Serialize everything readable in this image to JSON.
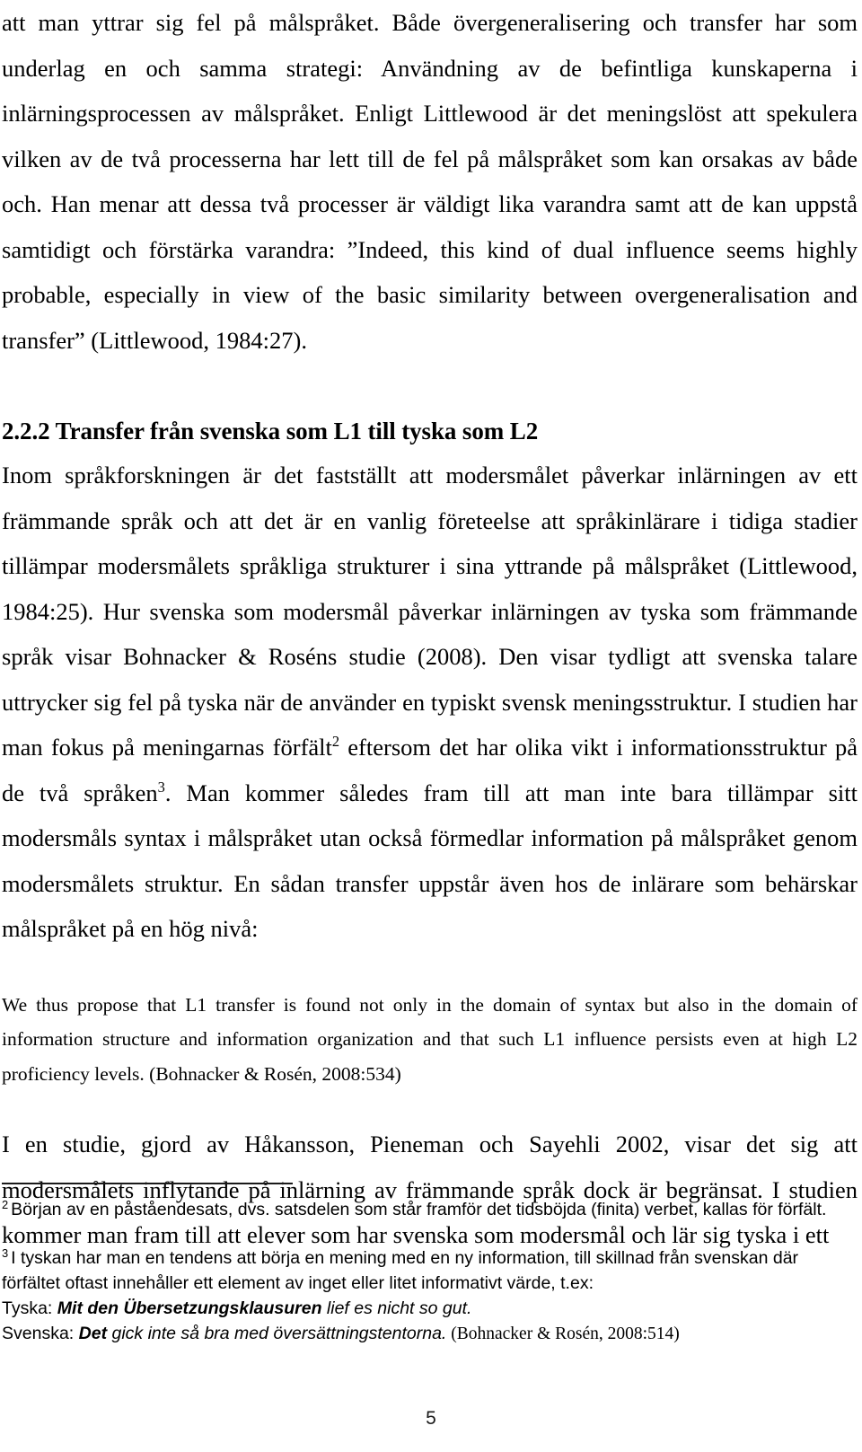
{
  "document": {
    "page_number": "5",
    "language": "sv"
  },
  "body": {
    "paragraph_1": "att man yttrar sig fel på målspråket. Både övergeneralisering och transfer har som underlag en och samma strategi: Användning av de befintliga kunskaperna i inlärningsprocessen av målspråket. Enligt Littlewood är det meningslöst att spekulera vilken av de två processerna har lett till de fel på målspråket som kan orsakas av både och. Han menar att dessa två processer är väldigt lika varandra samt att de kan uppstå samtidigt och förstärka varandra: ”Indeed, this kind of dual influence seems highly probable, especially in view of the basic similarity between overgeneralisation and transfer” (Littlewood, 1984:27).",
    "heading_2_2_2": "2.2.2 Transfer från svenska som L1 till tyska som L2",
    "paragraph_2_part_a": "Inom språkforskningen är det fastställt att modersmålet påverkar inlärningen av ett främmande språk och att det är en vanlig företeelse att språkinlärare i tidiga stadier tillämpar modersmålets språkliga strukturer i sina yttrande på målspråket (Littlewood, 1984:25). Hur svenska som modersmål påverkar inlärningen av tyska som främmande språk visar Bohnacker & Roséns studie (2008). Den visar tydligt att svenska talare uttrycker sig fel på tyska när de använder en typiskt svensk meningsstruktur. I studien har man fokus på meningarnas förfält",
    "footnote_ref_2": "2",
    "paragraph_2_part_b": " eftersom det har olika vikt i informationsstruktur på de två språken",
    "footnote_ref_3": "3",
    "paragraph_2_part_c": ". Man kommer således fram till att man inte bara tillämpar sitt modersmåls syntax i målspråket utan också förmedlar information på målspråket genom modersmålets struktur. En sådan transfer uppstår även hos de inlärare som behärskar målspråket på en hög nivå:",
    "blockquote": "We thus propose that L1 transfer is found not only in the domain of syntax but also in the domain of information structure and information organization and that such L1 influence persists even at high L2 proficiency levels. (Bohnacker & Rosén, 2008:534)",
    "paragraph_3": "I en studie, gjord av Håkansson, Pieneman och Sayehli 2002, visar det sig att modersmålets inflytande på inlärning av främmande språk dock är begränsat. I studien kommer man fram till att elever som har svenska som modersmål och lär sig tyska i ett"
  },
  "footnotes": {
    "note_2": {
      "number": "2",
      "text": "Början av en påståendesats, dvs. satsdelen som står framför det tidsböjda (finita) verbet, kallas för förfält."
    },
    "note_3": {
      "number": "3",
      "intro": "I tyskan har man en tendens att börja en mening med en ny information, till skillnad från svenskan där förfältet oftast innehåller ett element av inget eller litet informativt värde, t.ex:",
      "example_german_label": "Tyska: ",
      "example_german_bold": "Mit den Übersetzungsklausuren",
      "example_german_italic": " lief es nicht so gut.",
      "example_swedish_label": "Svenska: ",
      "example_swedish_bold": "Det",
      "example_swedish_italic": " gick inte så bra med översättningstentorna.",
      "example_citation": " (Bohnacker & Rosén, 2008:514)"
    }
  }
}
